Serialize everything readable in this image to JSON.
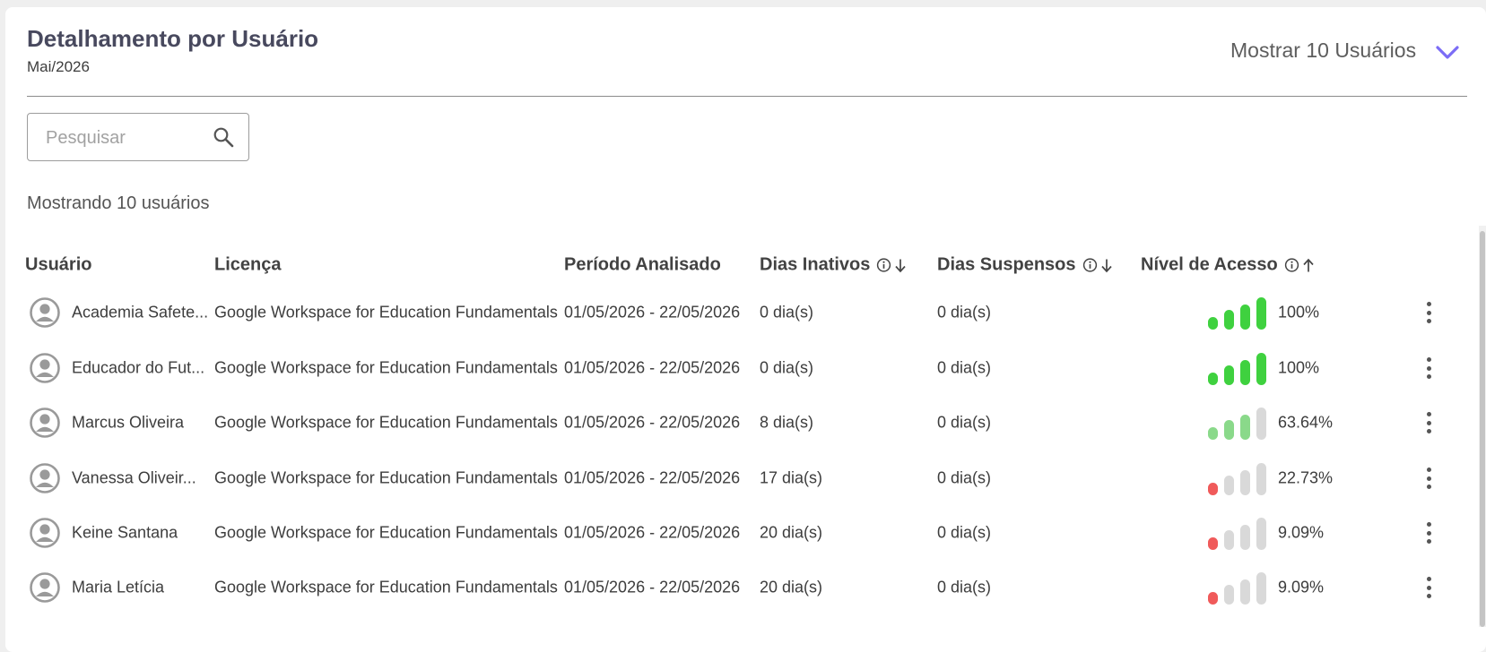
{
  "header": {
    "title": "Detalhamento por Usuário",
    "period": "Mai/2026",
    "show_count_label": "Mostrar 10 Usuários",
    "accent_color": "#7b6cf6"
  },
  "search": {
    "placeholder": "Pesquisar",
    "value": ""
  },
  "summary": "Mostrando 10 usuários",
  "table": {
    "columns": {
      "user": "Usuário",
      "license": "Licença",
      "period": "Período Analisado",
      "inactive_days": "Dias Inativos",
      "suspended_days": "Dias Suspensos",
      "access_level": "Nível de Acesso"
    },
    "sort": {
      "inactive_days": "desc",
      "suspended_days": "desc",
      "access_level": "asc"
    },
    "level_colors": {
      "high": "#3fd13f",
      "medium": "#8ad98a",
      "low": "#f05a5a",
      "empty": "#d9d9d9"
    },
    "rows": [
      {
        "user": "Academia Safete...",
        "license": "Google Workspace for Education Fundamentals",
        "period": "01/05/2026 - 22/05/2026",
        "inactive": "0 dia(s)",
        "suspended": "0 dia(s)",
        "level": "100%",
        "level_bars": 4,
        "level_tier": "high"
      },
      {
        "user": "Educador do Fut...",
        "license": "Google Workspace for Education Fundamentals",
        "period": "01/05/2026 - 22/05/2026",
        "inactive": "0 dia(s)",
        "suspended": "0 dia(s)",
        "level": "100%",
        "level_bars": 4,
        "level_tier": "high"
      },
      {
        "user": "Marcus Oliveira",
        "license": "Google Workspace for Education Fundamentals",
        "period": "01/05/2026 - 22/05/2026",
        "inactive": "8 dia(s)",
        "suspended": "0 dia(s)",
        "level": "63.64%",
        "level_bars": 3,
        "level_tier": "medium"
      },
      {
        "user": "Vanessa Oliveir...",
        "license": "Google Workspace for Education Fundamentals",
        "period": "01/05/2026 - 22/05/2026",
        "inactive": "17 dia(s)",
        "suspended": "0 dia(s)",
        "level": "22.73%",
        "level_bars": 1,
        "level_tier": "low"
      },
      {
        "user": "Keine Santana",
        "license": "Google Workspace for Education Fundamentals",
        "period": "01/05/2026 - 22/05/2026",
        "inactive": "20 dia(s)",
        "suspended": "0 dia(s)",
        "level": "9.09%",
        "level_bars": 1,
        "level_tier": "low"
      },
      {
        "user": "Maria Letícia",
        "license": "Google Workspace for Education Fundamentals",
        "period": "01/05/2026 - 22/05/2026",
        "inactive": "20 dia(s)",
        "suspended": "0 dia(s)",
        "level": "9.09%",
        "level_bars": 1,
        "level_tier": "low"
      }
    ]
  }
}
